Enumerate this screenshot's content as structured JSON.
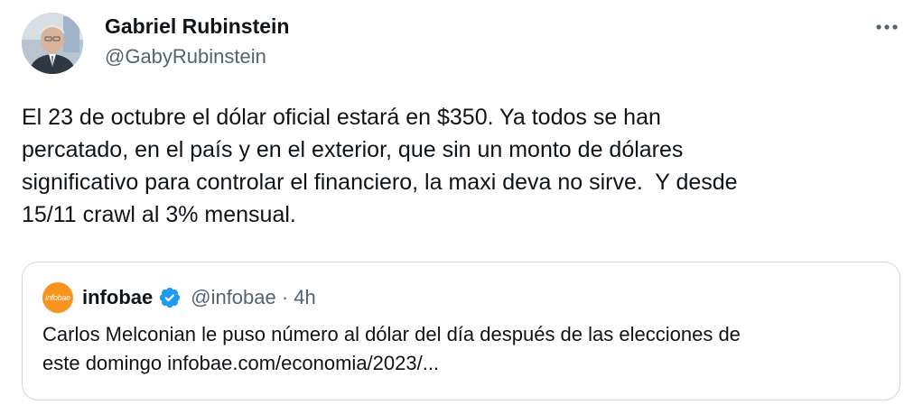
{
  "author": {
    "name": "Gabriel Rubinstein",
    "handle": "@GabyRubinstein",
    "avatar_icon": "profile-photo"
  },
  "tweet": {
    "text": "El 23 de octubre el dólar oficial estará en $350. Ya todos se han\npercatado, en el país y en el exterior, que sin un monto de dólares\nsignificativo para controlar el financiero, la maxi deva no sirve.  Y desde\n15/11 crawl al 3% mensual."
  },
  "quoted": {
    "logo_text": "infobae",
    "name": "infobae",
    "verified": true,
    "handle_time": "@infobae · 4h",
    "text": "Carlos Melconian le puso número al dólar del día después de las elecciones de\neste domingo infobae.com/economia/2023/..."
  },
  "colors": {
    "text": "#0f1419",
    "secondary": "#536471",
    "verified_blue": "#1d9bf0",
    "border": "#cfd9de",
    "infobae_orange": "#f7941d"
  }
}
